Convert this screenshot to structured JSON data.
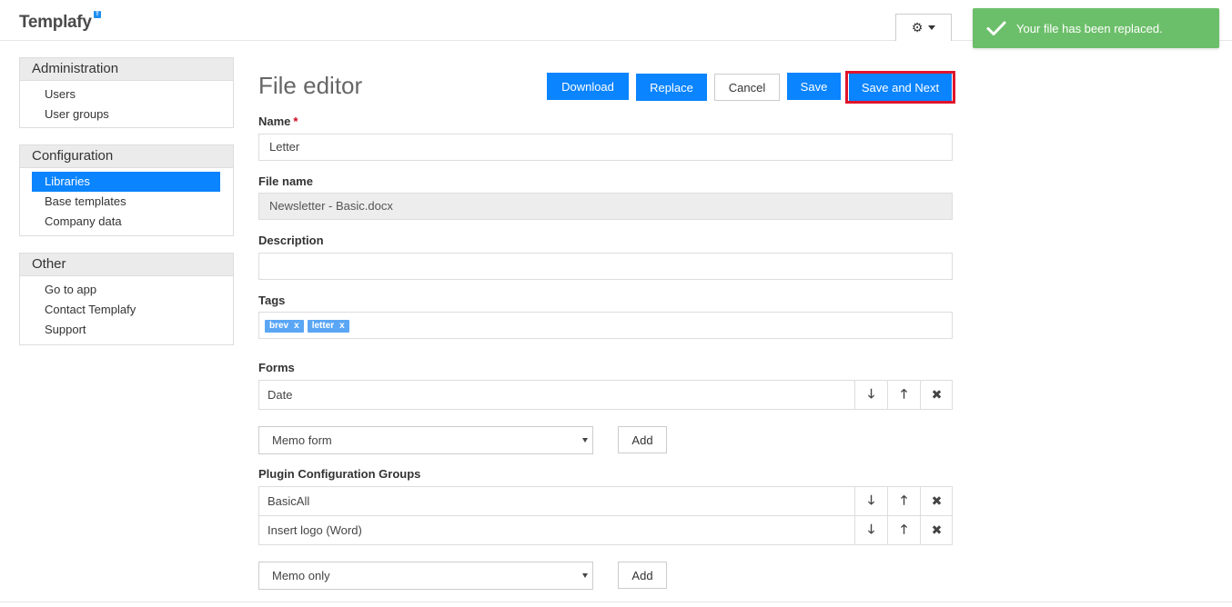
{
  "app": {
    "name": "Templafy",
    "badge": "T"
  },
  "toast": {
    "message": "Your file has been replaced."
  },
  "sidebar": {
    "administration": {
      "title": "Administration",
      "items": [
        "Users",
        "User groups"
      ]
    },
    "configuration": {
      "title": "Configuration",
      "items": [
        "Libraries",
        "Base templates",
        "Company data"
      ],
      "active": "Libraries"
    },
    "other": {
      "title": "Other",
      "items": [
        "Go to app",
        "Contact Templafy",
        "Support"
      ]
    }
  },
  "editor": {
    "title": "File editor",
    "buttons": {
      "download": "Download",
      "replace": "Replace",
      "cancel": "Cancel",
      "save": "Save",
      "save_next": "Save and Next"
    },
    "name_label": "Name",
    "required_mark": "*",
    "name_value": "Letter",
    "file_name_label": "File name",
    "file_name_value": "Newsletter - Basic.docx",
    "description_label": "Description",
    "description_value": "",
    "tags_label": "Tags",
    "tags": [
      "brev",
      "letter"
    ],
    "tag_remove": "x",
    "forms_label": "Forms",
    "forms": [
      "Date"
    ],
    "forms_select": "Memo form",
    "add_label": "Add",
    "plugin_label": "Plugin Configuration Groups",
    "plugins": [
      "BasicAll",
      "Insert logo (Word)"
    ],
    "plugin_select": "Memo only"
  },
  "colors": {
    "primary": "#0a84ff",
    "toast": "#6cbf6a",
    "highlight": "#e0142c"
  }
}
